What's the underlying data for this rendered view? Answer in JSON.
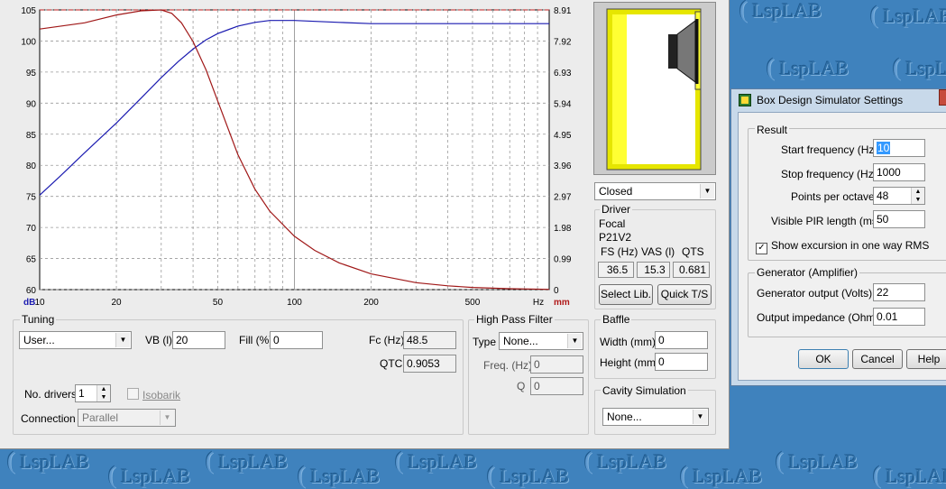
{
  "watermark": {
    "text": "LspLAB",
    "symbol": "("
  },
  "chart_data": {
    "type": "line",
    "x_scale": "log",
    "xlim": [
      10,
      1000
    ],
    "ylim": [
      60,
      105
    ],
    "y2lim": [
      0,
      8.91
    ],
    "left_axis_unit": "dB",
    "right_axis_unit": "mm",
    "x_unit": "Hz",
    "x_ticks": [
      "10",
      "20",
      "50",
      "100",
      "200",
      "500"
    ],
    "y_ticks": [
      "105",
      "100",
      "95",
      "90",
      "85",
      "80",
      "75",
      "70",
      "65",
      "60"
    ],
    "y2_ticks": [
      "8.91",
      "7.92",
      "6.93",
      "5.94",
      "4.95",
      "3.96",
      "2.97",
      "1.98",
      "0.99",
      "0"
    ],
    "grid": true,
    "reference_level_db": 105,
    "series": [
      {
        "color": "#1a1ab0",
        "axis": "left",
        "x": [
          10,
          12,
          15,
          20,
          25,
          30,
          35,
          40,
          45,
          50,
          60,
          70,
          80,
          100,
          150,
          200,
          300,
          500,
          700,
          1000
        ],
        "y": [
          75.2,
          78.2,
          82.0,
          86.8,
          90.8,
          94.1,
          96.7,
          98.7,
          100.2,
          101.2,
          102.4,
          103.0,
          103.3,
          103.3,
          103.0,
          102.8,
          102.8,
          102.8,
          102.8,
          102.8
        ]
      },
      {
        "color": "#a01818",
        "axis": "right",
        "x": [
          10,
          15,
          20,
          25,
          30,
          33,
          36,
          40,
          45,
          50,
          60,
          70,
          80,
          100,
          120,
          150,
          200,
          300,
          400,
          500,
          700,
          1000
        ],
        "y": [
          8.3,
          8.5,
          8.75,
          8.88,
          8.91,
          8.8,
          8.5,
          7.9,
          7.0,
          6.0,
          4.3,
          3.2,
          2.5,
          1.7,
          1.25,
          0.85,
          0.5,
          0.22,
          0.12,
          0.07,
          0.03,
          0.01
        ]
      }
    ]
  },
  "box_type": "Closed",
  "driver": {
    "title": "Driver",
    "brand": "Focal",
    "model": "P21V2",
    "headers": [
      "FS (Hz)",
      "VAS (l)",
      "QTS"
    ],
    "values": [
      "36.5",
      "15.3",
      "0.681"
    ],
    "select_lib_label": "Select Lib.",
    "quick_ts_label": "Quick T/S"
  },
  "tuning": {
    "title": "Tuning",
    "preset": "User...",
    "vb_label": "VB (l)",
    "vb_value": "20",
    "fill_label": "Fill (%)",
    "fill_value": "0",
    "fc_label": "Fc (Hz)",
    "fc_value": "48.5",
    "qtc_label": "QTC",
    "qtc_value": "0.9053",
    "drivers_label": "No. drivers",
    "drivers_value": "1",
    "isobarik_label": "Isobarik",
    "connection_label": "Connection",
    "connection_value": "Parallel"
  },
  "hpf": {
    "title": "High Pass Filter",
    "type_label": "Type",
    "type_value": "None...",
    "freq_label": "Freq. (Hz)",
    "freq_value": "0",
    "q_label": "Q",
    "q_value": "0"
  },
  "baffle": {
    "title": "Baffle",
    "width_label": "Width (mm)",
    "width_value": "0",
    "height_label": "Height (mm)",
    "height_value": "0"
  },
  "cavity": {
    "title": "Cavity Simulation",
    "value": "None..."
  },
  "dialog": {
    "title": "Box Design Simulator Settings",
    "result_title": "Result",
    "start_label": "Start frequency (Hz)",
    "start_value": "10",
    "stop_label": "Stop frequency (Hz)",
    "stop_value": "1000",
    "ppo_label": "Points per octave",
    "ppo_value": "48",
    "pir_label": "Visible PIR length (ms)",
    "pir_value": "50",
    "excursion_label": "Show excursion in one way RMS",
    "generator_title": "Generator (Amplifier)",
    "gen_output_label": "Generator output (Volts)",
    "gen_output_value": "22",
    "impedance_label": "Output impedance (Ohms)",
    "impedance_value": "0.01",
    "ok_label": "OK",
    "cancel_label": "Cancel",
    "help_label": "Help"
  },
  "colors": {
    "window": "#ececec",
    "desktop": "#3f82bd",
    "grid": "#9a9a9a",
    "box_fill": "#ffff33"
  }
}
